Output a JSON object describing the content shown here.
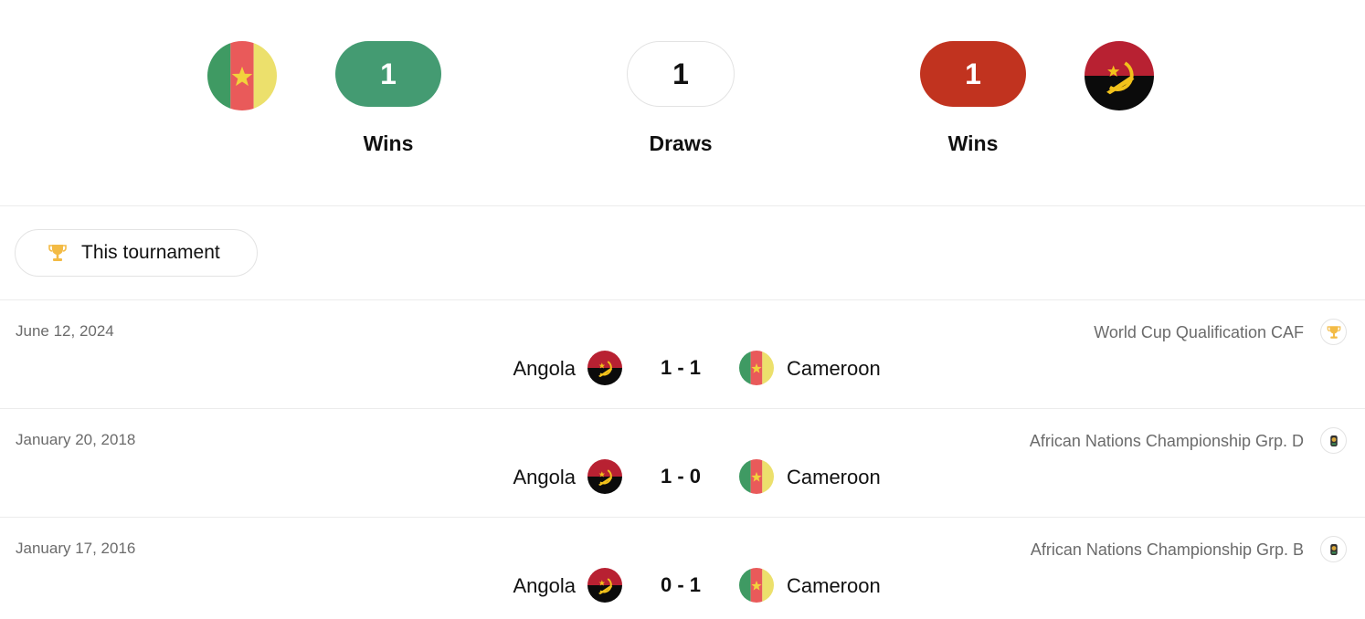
{
  "head_to_head": {
    "home_team_flag": "cameroon-flag",
    "away_team_flag": "angola-flag",
    "home_wins": "1",
    "draws": "1",
    "away_wins": "1",
    "home_wins_label": "Wins",
    "draws_label": "Draws",
    "away_wins_label": "Wins",
    "colors": {
      "home_wins": "#449b72",
      "away_wins": "#c1331f"
    }
  },
  "filter": {
    "icon": "trophy-icon",
    "label": "This tournament"
  },
  "matches": [
    {
      "date": "June 12, 2024",
      "competition": "World Cup Qualification CAF",
      "competition_icon": "trophy-icon",
      "home": "Angola",
      "score": "1 - 1",
      "away": "Cameroon"
    },
    {
      "date": "January 20, 2018",
      "competition": "African Nations Championship Grp. D",
      "competition_icon": "chan-logo-icon",
      "home": "Angola",
      "score": "1 - 0",
      "away": "Cameroon"
    },
    {
      "date": "January 17, 2016",
      "competition": "African Nations Championship Grp. B",
      "competition_icon": "chan-logo-icon",
      "home": "Angola",
      "score": "0 - 1",
      "away": "Cameroon"
    }
  ]
}
